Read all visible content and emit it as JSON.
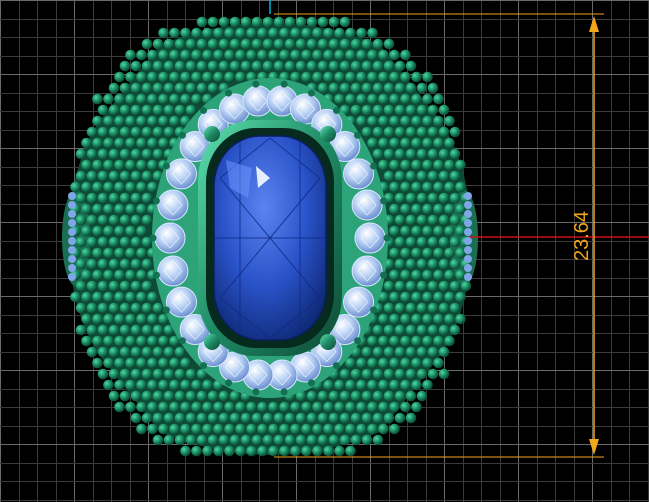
{
  "viewport": {
    "background_color": "#000000",
    "grid_minor_color": "#3a3a3a",
    "grid_major_color": "#6a6a6a"
  },
  "axes": {
    "vertical_axis_color": "#00b7d8",
    "horizontal_axis_color": "#cc1010"
  },
  "dimension": {
    "value": "23.64",
    "color": "#f2a61a"
  },
  "model": {
    "name_icon": "ring-jewelry-model",
    "metal_color": "#1e8a64",
    "bead_color": "#1f9b6f",
    "halo_stone_color": "#b9d2f5",
    "center_stone_color": "#2a53c9",
    "center_stone_highlight": "#e6efff"
  }
}
